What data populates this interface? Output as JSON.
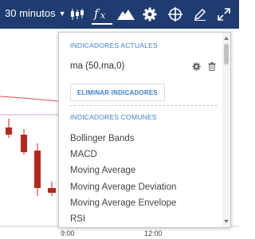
{
  "toolbar": {
    "timeframe_label": "30 minutos",
    "icons": [
      "candlestick-icon",
      "function-icon",
      "mountain-icon",
      "gear-icon",
      "crosshair-icon",
      "pencil-icon",
      "expand-icon"
    ],
    "background": "#1f3c70"
  },
  "panel": {
    "current_title": "INDICADORES ACTUALES",
    "current_indicators": [
      {
        "label": "ma (50,ma,0)"
      }
    ],
    "remove_label": "ELIMINAR INDICADORES",
    "common_title": "INDICADORES COMUNES",
    "common_indicators": [
      "Bollinger Bands",
      "MACD",
      "Moving Average",
      "Moving Average Deviation",
      "Moving Average Envelope",
      "RSI"
    ],
    "accent": "#3b7fd4"
  },
  "chart": {
    "x_labels": [
      "9:00",
      "12:00"
    ],
    "colors": {
      "bear": "#b52a1c",
      "ma_line": "#d9534f",
      "ref_line": "#e6a0e6"
    }
  }
}
